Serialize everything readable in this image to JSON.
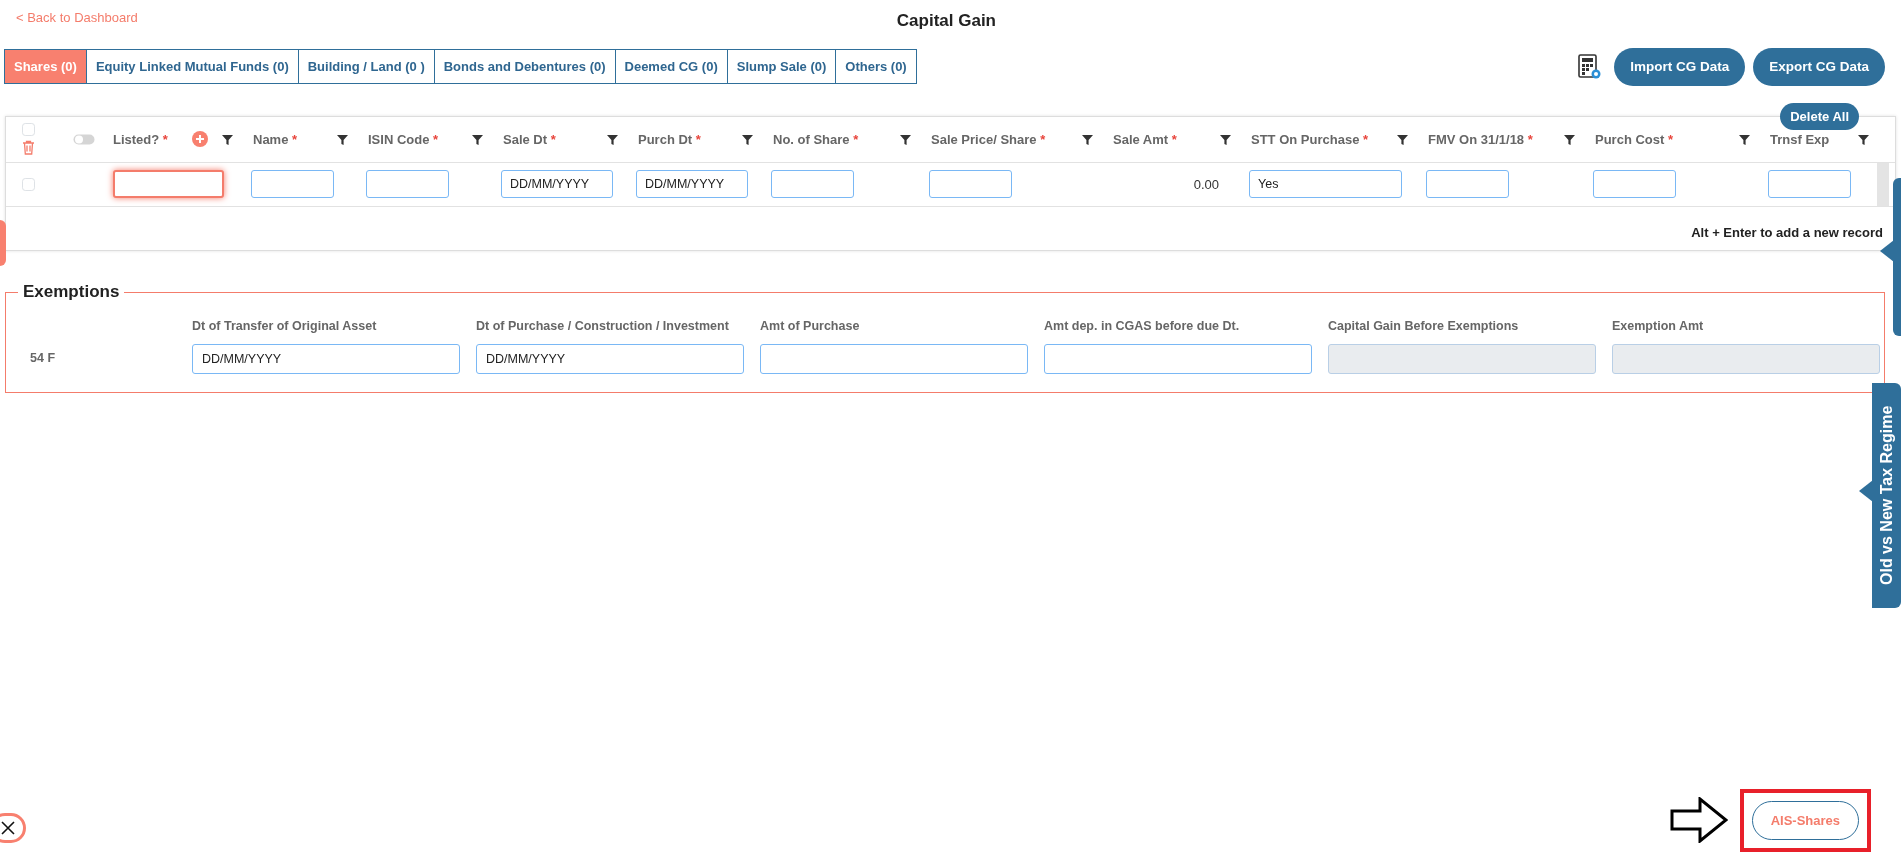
{
  "back_link": "< Back to Dashboard",
  "title": "Capital Gain",
  "tabs": [
    {
      "label": "Shares (0)",
      "selected": true
    },
    {
      "label": "Equity Linked Mutual Funds (0)",
      "selected": false
    },
    {
      "label": "Building / Land (0 )",
      "selected": false
    },
    {
      "label": "Bonds and Debentures (0)",
      "selected": false
    },
    {
      "label": "Deemed CG (0)",
      "selected": false
    },
    {
      "label": "Slump Sale (0)",
      "selected": false
    },
    {
      "label": "Others (0)",
      "selected": false
    }
  ],
  "toolbar_buttons": [
    "Import CG Data",
    "Export CG Data"
  ],
  "grid": {
    "delete_all": "Delete All",
    "select_all_checked": false,
    "listed_toggle_on": false,
    "columns": [
      {
        "label": "Listed?",
        "mark": "*"
      },
      {
        "label": "Name",
        "mark": "*"
      },
      {
        "label": "ISIN Code",
        "mark": "*"
      },
      {
        "label": "Sale Dt",
        "mark": "*"
      },
      {
        "label": "Purch Dt",
        "mark": "*"
      },
      {
        "label": "No. of Share",
        "mark": "*"
      },
      {
        "label": "Sale Price/ Share",
        "mark": "*"
      },
      {
        "label": "Sale Amt",
        "mark": "*"
      },
      {
        "label": "STT On Purchase",
        "mark": "*"
      },
      {
        "label": "FMV On 31/1/18",
        "mark": "*"
      },
      {
        "label": "Purch Cost",
        "mark": "*"
      },
      {
        "label": "Trnsf Exp"
      }
    ],
    "rows": [
      {
        "checked": false,
        "cells": [
          {
            "kind": "input",
            "invalid": true
          },
          {
            "kind": "input",
            "invalid": false
          },
          {
            "kind": "input",
            "invalid": false
          },
          {
            "kind": "input",
            "placeholder": "DD/MM/YYYY",
            "invalid": false
          },
          {
            "kind": "input",
            "placeholder": "DD/MM/YYYY",
            "invalid": false
          },
          {
            "kind": "input",
            "invalid": false
          },
          {
            "kind": "input",
            "invalid": false
          },
          {
            "kind": "text",
            "value": "0.00"
          },
          {
            "kind": "input",
            "value": "Yes",
            "invalid": false
          },
          {
            "kind": "input",
            "invalid": false
          },
          {
            "kind": "input",
            "invalid": false
          },
          {
            "kind": "input",
            "invalid": false
          }
        ]
      }
    ],
    "hint": "Alt + Enter to add a new record"
  },
  "exemptions": {
    "legend": "Exemptions",
    "columns": [
      "Dt of Transfer of Original Asset",
      "Dt of Purchase / Construction / Investment",
      "Amt of Purchase",
      "Amt dep. in CGAS before due Dt.",
      "Capital Gain Before Exemptions",
      "Exemption Amt"
    ],
    "rows": [
      {
        "label": "54 F",
        "fields": [
          {
            "placeholder": "DD/MM/YYYY",
            "disabled": false
          },
          {
            "placeholder": "DD/MM/YYYY",
            "disabled": false
          },
          {
            "disabled": false
          },
          {
            "disabled": false
          },
          {
            "disabled": true
          },
          {
            "disabled": true
          }
        ]
      }
    ]
  },
  "side_tab": "Old vs New Tax Regime",
  "ais_button": "AIS-Shares"
}
